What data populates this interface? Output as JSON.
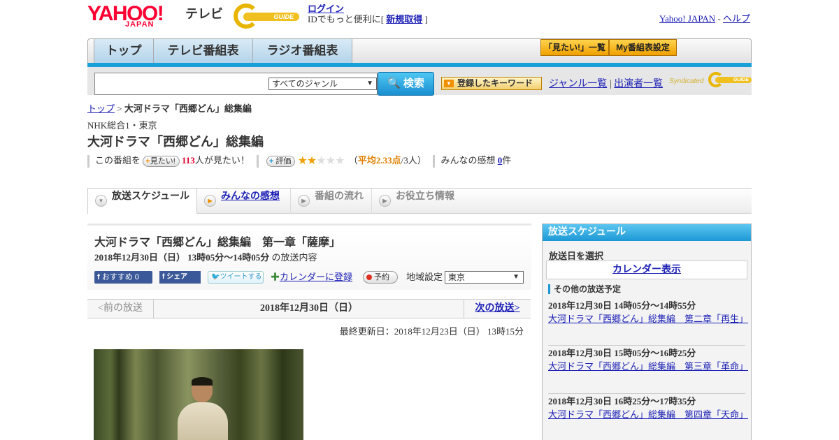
{
  "header": {
    "yahoo_logo": "YAHOO!",
    "yahoo_sub": "JAPAN",
    "tv_label": "テレビ",
    "gguide_label": "GUIDE",
    "login": "ログイン",
    "login_desc_pre": "IDでもっと便利に[",
    "signup": "新規取得",
    "login_desc_post": "]",
    "yahoo_japan_link": "Yahoo! JAPAN",
    "dash": "-",
    "help_link": "ヘルプ"
  },
  "nav": {
    "tabs": [
      {
        "label": "トップ"
      },
      {
        "label": "テレビ番組表"
      },
      {
        "label": "ラジオ番組表"
      }
    ],
    "mitai_list": "「見たい!」一覧",
    "my_schedule": "My番組表設定"
  },
  "search": {
    "genre_selected": "すべてのジャンル",
    "button": "検索",
    "keyword_button": "登録したキーワード",
    "genre_list": "ジャンル一覧",
    "sep": "|",
    "cast_list": "出演者一覧",
    "syndicated": "Syndicated",
    "syn_guide": "GUIDE"
  },
  "breadcrumb": {
    "top": "トップ",
    "sep": ">",
    "current": "大河ドラマ「西郷どん」総集編"
  },
  "program": {
    "channel": "NHK総合1・東京",
    "title": "大河ドラマ「西郷どん」総集編",
    "this_program": "この番組を",
    "mitai_btn": "見たい!",
    "mitai_count": "113",
    "mitai_suffix": "人が見たい！",
    "rating_btn": "評価",
    "rating_value": 2.33,
    "rating_avg_label": "平均2.33点",
    "rating_count": "/3人",
    "paren_open": "（",
    "paren_close": "）",
    "impressions_label": "みんなの感想",
    "impressions_count": "0",
    "impressions_suffix": "件"
  },
  "subtabs": [
    {
      "label": "放送スケジュール"
    },
    {
      "label": "みんなの感想"
    },
    {
      "label": "番組の流れ"
    },
    {
      "label": "お役立ち情報"
    }
  ],
  "episode": {
    "title": "大河ドラマ「西郷どん」総集編　第一章「薩摩」",
    "date_time": "2018年12月30日（日） 13時05分～14時05分",
    "date_suffix": "の放送内容",
    "fb_recommend": "おすすめ 0",
    "fb_share": "シェア",
    "tweet": "ツイートする",
    "calendar": "カレンダーに登録",
    "reserve": "予約",
    "region_label": "地域設定",
    "region_selected": "東京"
  },
  "pager": {
    "prev": "<前の放送",
    "current": "2018年12月30日（日）",
    "next": "次の放送>"
  },
  "updated": "最終更新日：2018年12月23日（日） 13時15分",
  "sidebar": {
    "header": "放送スケジュール",
    "select_date": "放送日を選択",
    "calendar_view": "カレンダー表示",
    "other_schedules": "その他の放送予定",
    "items": [
      {
        "datetime": "2018年12月30日 14時05分～14時55分",
        "title": "大河ドラマ「西郷どん」総集編　第二章「再生」"
      },
      {
        "datetime": "2018年12月30日 15時05分～16時25分",
        "title": "大河ドラマ「西郷どん」総集編　第三章「革命」"
      },
      {
        "datetime": "2018年12月30日 16時25分～17時35分",
        "title": "大河ドラマ「西郷どん」総集編　第四章「天命」"
      }
    ]
  },
  "colors": {
    "accent_blue": "#1aa0d8",
    "link": "#1d21b6",
    "yahoo_red": "#ff0033",
    "star": "#f0a000"
  }
}
